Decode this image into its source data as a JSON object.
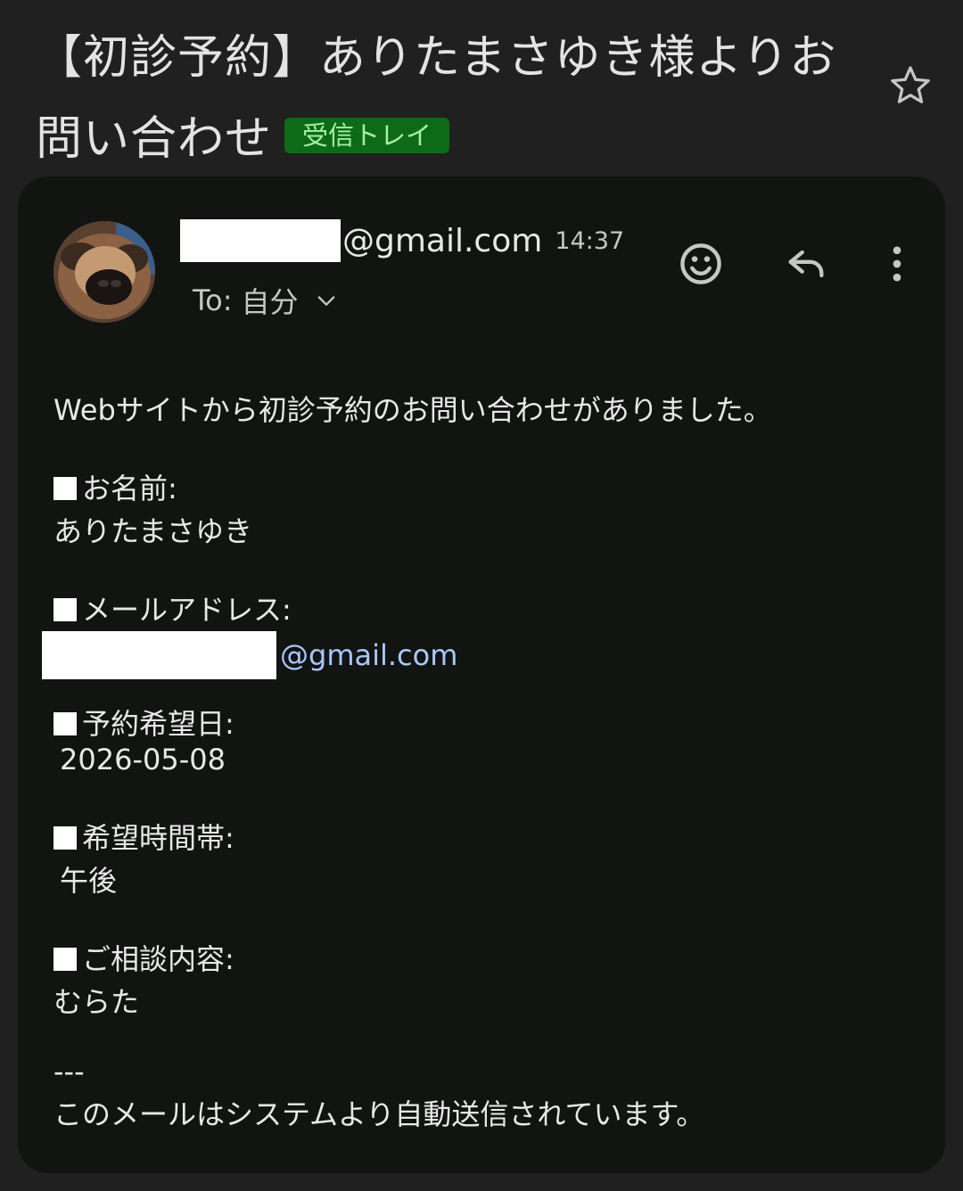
{
  "email": {
    "subject": "【初診予約】ありたまさゆき様よりお問い合わせ",
    "label": "受信トレイ",
    "sender": {
      "domain": "@gmail.com",
      "time": "14:37",
      "to_label": "To:",
      "to_value": "自分"
    },
    "actions": {
      "emoji_icon": "add-reaction-icon",
      "reply_icon": "reply-icon",
      "more_icon": "more-vert-icon"
    },
    "body": {
      "intro": "Webサイトから初診予約のお問い合わせがありました。",
      "name_label": "お名前:",
      "name_value": "ありたまさゆき",
      "email_label": "メールアドレス:",
      "email_domain": "@gmail.com",
      "date_label": "予約希望日:",
      "date_value": "2026-05-08",
      "time_label": "希望時間帯:",
      "time_value": "午後",
      "consult_label": "ご相談内容:",
      "consult_value": "むらた",
      "separator": "---",
      "footer": "このメールはシステムより自動送信されています。"
    }
  },
  "colors": {
    "background": "#1f201f",
    "card": "#121412",
    "label_chip_bg": "#0d6b17",
    "label_chip_text": "#a8f0a0",
    "link": "#a8c7fa"
  }
}
